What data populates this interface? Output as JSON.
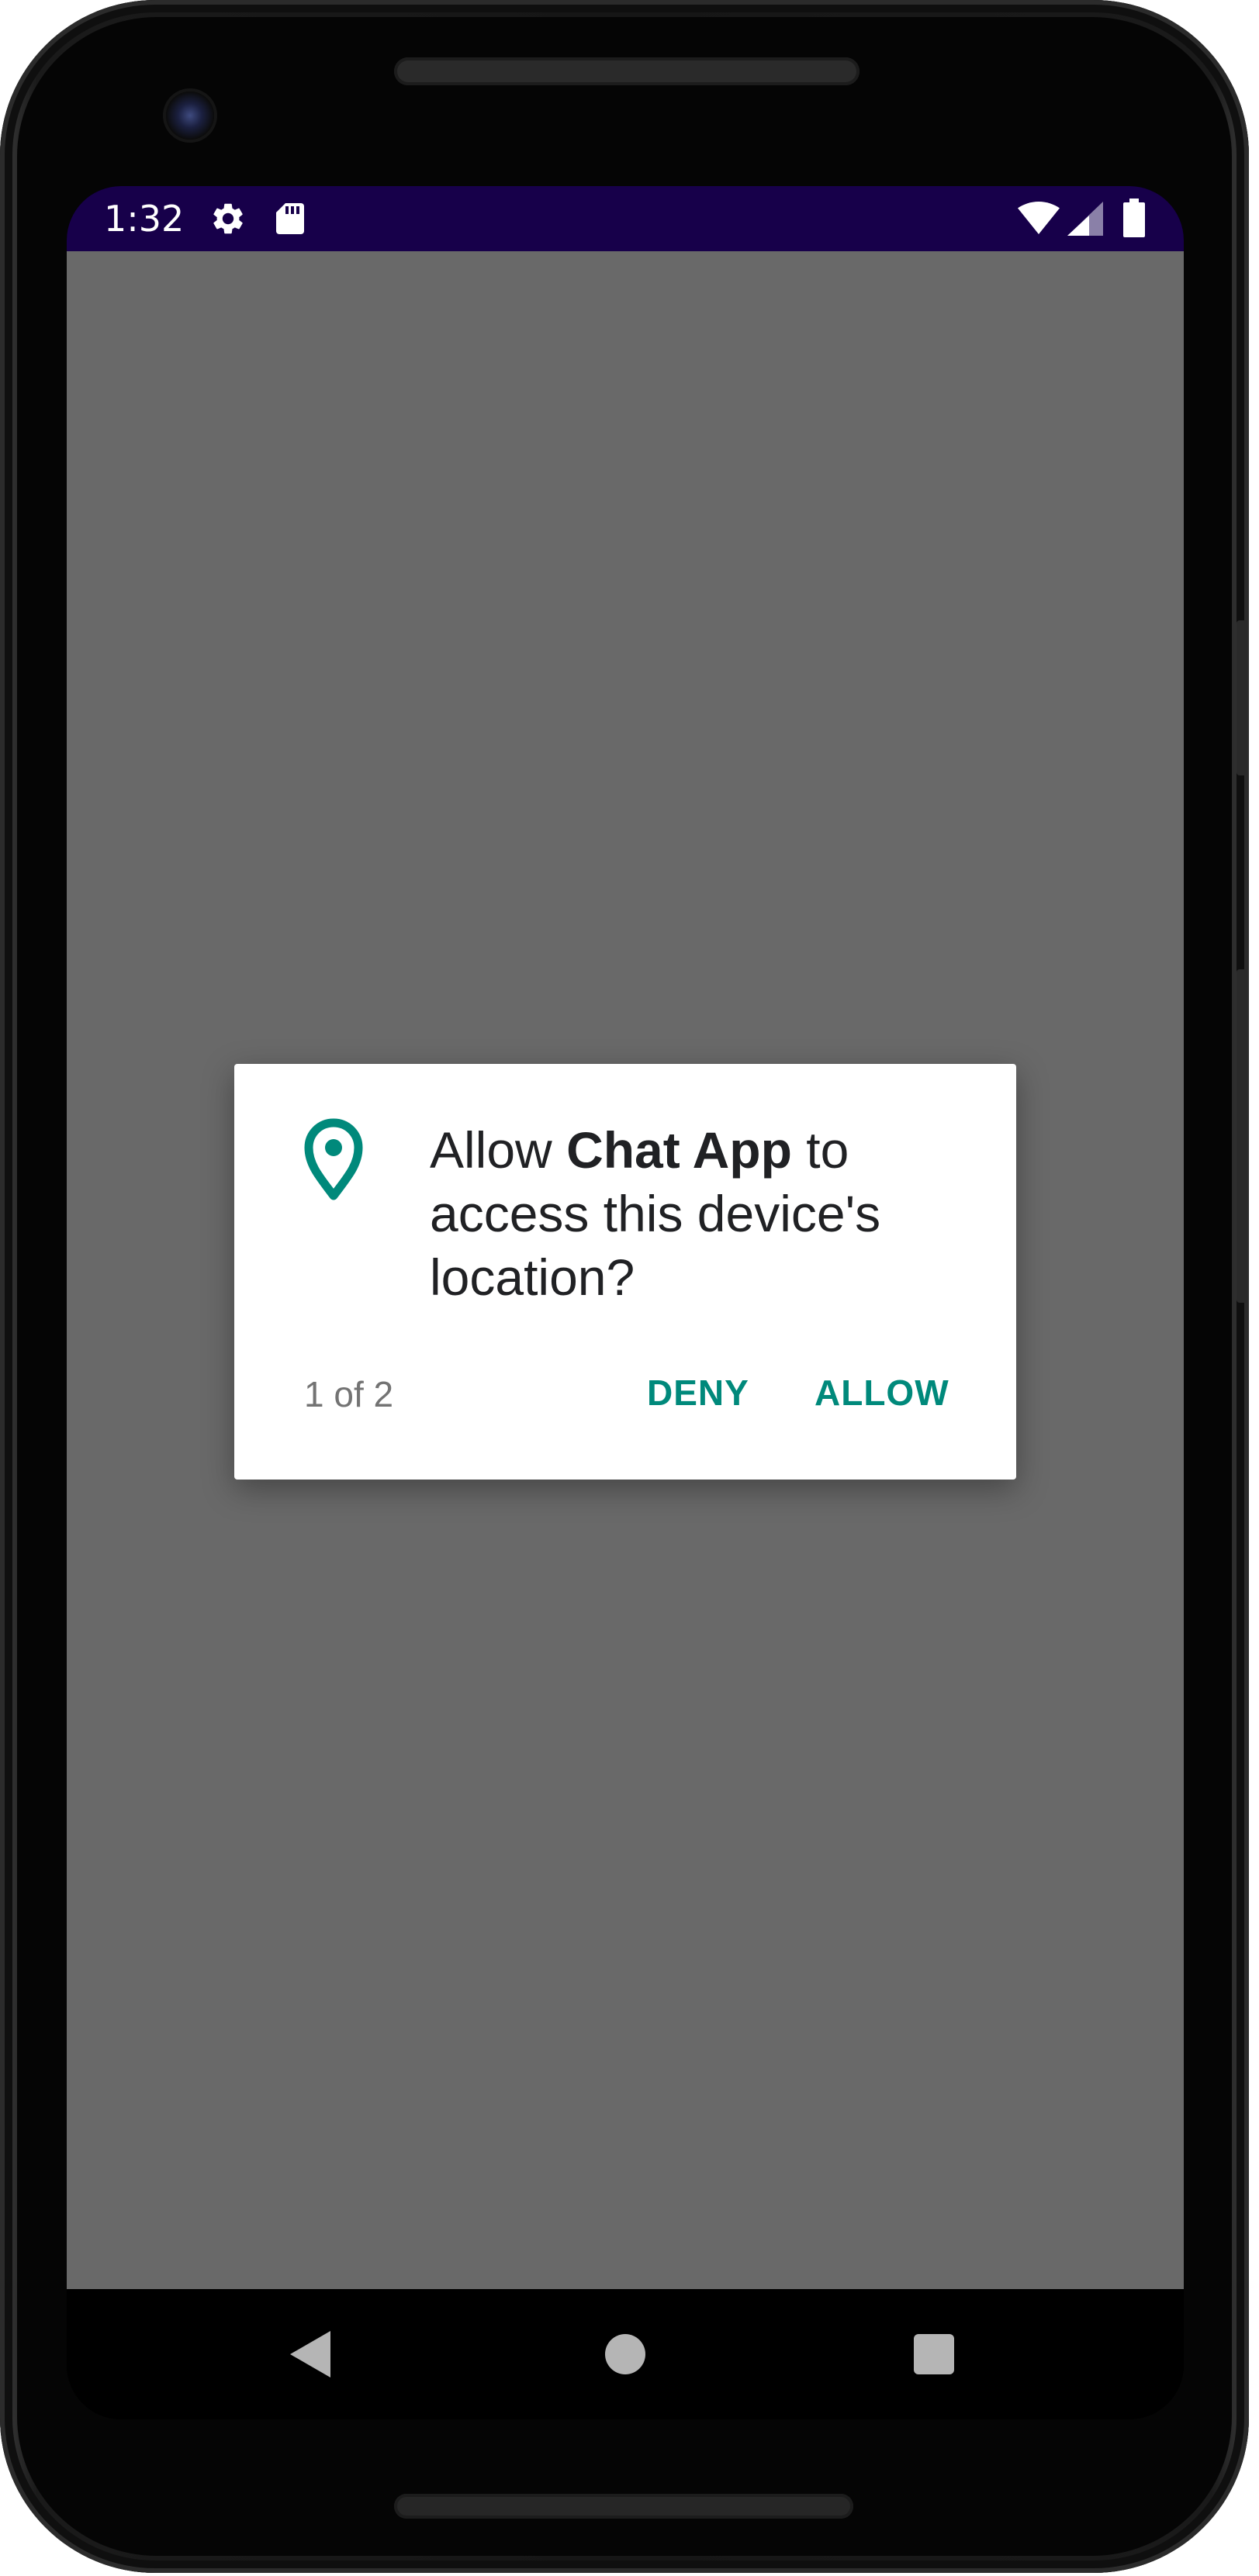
{
  "status_bar": {
    "time": "1:32",
    "icons": [
      "gear-icon",
      "sd-card-icon",
      "wifi-icon",
      "cell-signal-icon",
      "battery-icon"
    ],
    "background_color": "#17004a"
  },
  "dialog": {
    "message_prefix": "Allow ",
    "app_name": "Chat App",
    "message_suffix": " to access this device's location?",
    "counter": "1 of 2",
    "deny_label": "DENY",
    "allow_label": "ALLOW",
    "icon": "location-pin-icon",
    "accent_color": "#00897b"
  },
  "nav_bar": {
    "buttons": [
      "back-icon",
      "home-icon",
      "recents-icon"
    ]
  }
}
